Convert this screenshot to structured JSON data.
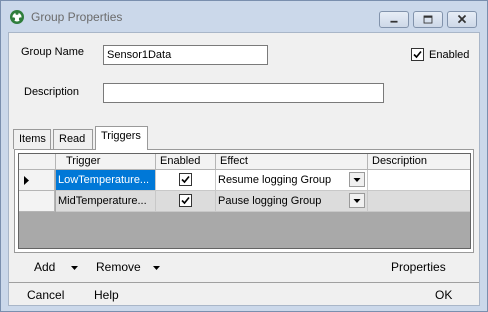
{
  "window": {
    "title": "Group Properties"
  },
  "form": {
    "group_name_label": "Group Name",
    "group_name_value": "Sensor1Data",
    "enabled_label": "Enabled",
    "enabled_checked": true,
    "description_label": "Description",
    "description_value": ""
  },
  "tabs": [
    {
      "label": "Items",
      "active": false
    },
    {
      "label": "Read",
      "active": false
    },
    {
      "label": "Triggers",
      "active": true
    }
  ],
  "grid": {
    "columns": [
      "Trigger",
      "Enabled",
      "Effect",
      "Description"
    ],
    "rows": [
      {
        "trigger": "LowTemperature...",
        "enabled": true,
        "effect": "Resume logging Group",
        "description": "",
        "current": true
      },
      {
        "trigger": "MidTemperature...",
        "enabled": true,
        "effect": "Pause logging Group",
        "description": "",
        "current": false
      }
    ]
  },
  "toolbar": {
    "add_label": "Add",
    "remove_label": "Remove",
    "properties_label": "Properties"
  },
  "footer": {
    "cancel_label": "Cancel",
    "help_label": "Help",
    "ok_label": "OK"
  },
  "colors": {
    "frame": "#cbd8ea",
    "selection": "#0078d7",
    "grid_background": "#a9a9a9"
  },
  "icons": [
    "app-icon",
    "minimize-icon",
    "maximize-icon",
    "close-icon",
    "check-icon",
    "row-pointer-icon",
    "dropdown-arrow-icon"
  ]
}
